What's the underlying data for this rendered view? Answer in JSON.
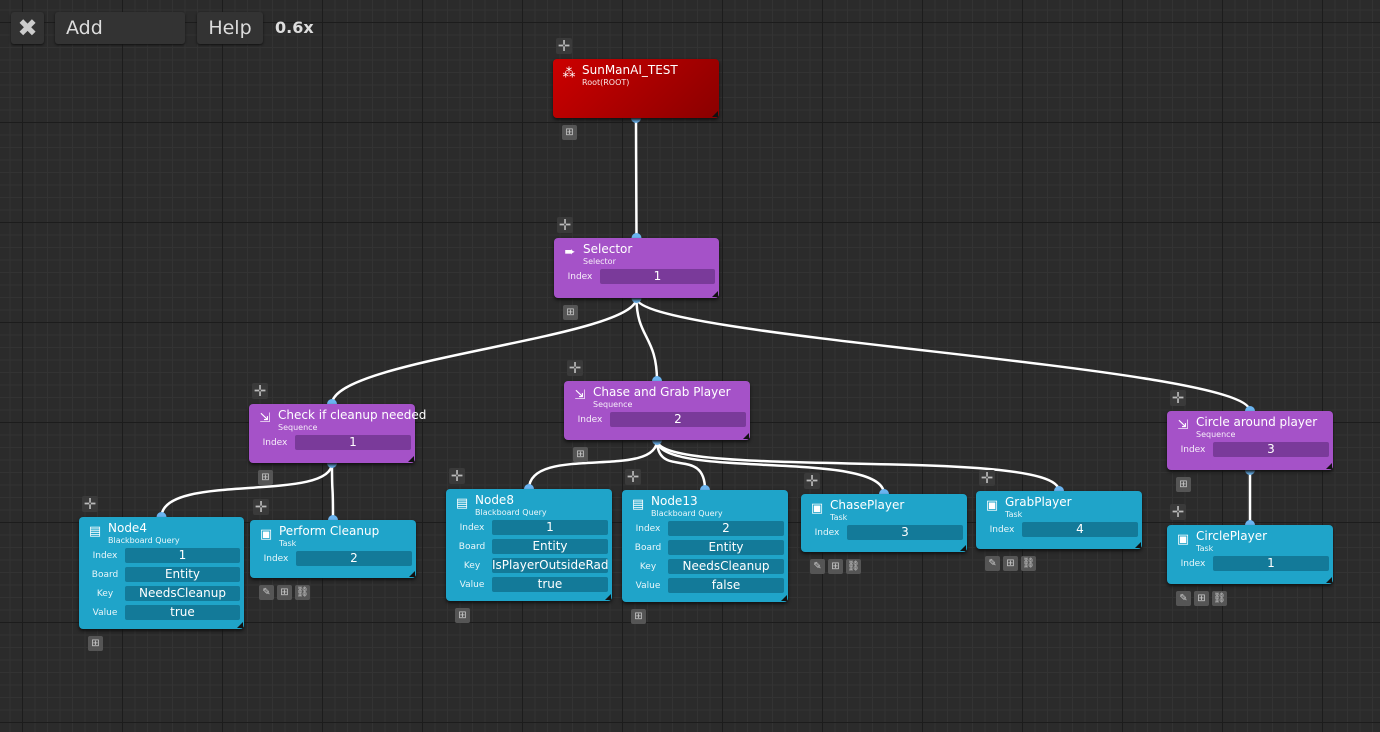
{
  "toolbar": {
    "close_icon": "close-icon",
    "add_label": "Add",
    "help_label": "Help",
    "zoom_level": "0.6x"
  },
  "colors": {
    "root": "#c00000",
    "composite": "#a552c8",
    "task": "#1fa4c9",
    "edge": "#ffffff",
    "port": "#6ab4f0"
  },
  "nodes": [
    {
      "id": "root",
      "kind": "root",
      "icon": "tree-icon",
      "title": "SunManAI_TEST",
      "subtitle": "Root(ROOT)",
      "fields": [],
      "tools": [
        "add"
      ]
    },
    {
      "id": "selector",
      "kind": "comp",
      "icon": "selector-icon",
      "title": "Selector",
      "subtitle": "Selector",
      "fields": [
        {
          "label": "Index",
          "value": "1"
        }
      ],
      "tools": [
        "add"
      ]
    },
    {
      "id": "check",
      "kind": "comp",
      "icon": "sequence-icon",
      "title": "Check if cleanup needed",
      "subtitle": "Sequence",
      "fields": [
        {
          "label": "Index",
          "value": "1"
        }
      ],
      "tools": [
        "add"
      ]
    },
    {
      "id": "chase",
      "kind": "comp",
      "icon": "sequence-icon",
      "title": "Chase and Grab Player",
      "subtitle": "Sequence",
      "fields": [
        {
          "label": "Index",
          "value": "2"
        }
      ],
      "tools": [
        "add"
      ]
    },
    {
      "id": "circle",
      "kind": "comp",
      "icon": "sequence-icon",
      "title": "Circle around player",
      "subtitle": "Sequence",
      "fields": [
        {
          "label": "Index",
          "value": "3"
        }
      ],
      "tools": [
        "add"
      ]
    },
    {
      "id": "node4",
      "kind": "task",
      "icon": "blackboard-icon",
      "title": "Node4",
      "subtitle": "Blackboard Query",
      "fields": [
        {
          "label": "Index",
          "value": "1"
        },
        {
          "label": "Board",
          "value": "Entity"
        },
        {
          "label": "Key",
          "value": "NeedsCleanup"
        },
        {
          "label": "Value",
          "value": "true"
        }
      ],
      "tools": [
        "add"
      ]
    },
    {
      "id": "perform",
      "kind": "task",
      "icon": "task-icon",
      "title": "Perform Cleanup",
      "subtitle": "Task",
      "fields": [
        {
          "label": "Index",
          "value": "2"
        }
      ],
      "tools": [
        "edit",
        "add",
        "link"
      ]
    },
    {
      "id": "node8",
      "kind": "task",
      "icon": "blackboard-icon",
      "title": "Node8",
      "subtitle": "Blackboard Query",
      "fields": [
        {
          "label": "Index",
          "value": "1"
        },
        {
          "label": "Board",
          "value": "Entity"
        },
        {
          "label": "Key",
          "value": "IsPlayerOutsideRadius"
        },
        {
          "label": "Value",
          "value": "true"
        }
      ],
      "tools": [
        "add"
      ]
    },
    {
      "id": "node13",
      "kind": "task",
      "icon": "blackboard-icon",
      "title": "Node13",
      "subtitle": "Blackboard Query",
      "fields": [
        {
          "label": "Index",
          "value": "2"
        },
        {
          "label": "Board",
          "value": "Entity"
        },
        {
          "label": "Key",
          "value": "NeedsCleanup"
        },
        {
          "label": "Value",
          "value": "false"
        }
      ],
      "tools": [
        "add"
      ]
    },
    {
      "id": "chaseplayer",
      "kind": "task",
      "icon": "task-icon",
      "title": "ChasePlayer",
      "subtitle": "Task",
      "fields": [
        {
          "label": "Index",
          "value": "3"
        }
      ],
      "tools": [
        "edit",
        "add",
        "link"
      ]
    },
    {
      "id": "grabplayer",
      "kind": "task",
      "icon": "task-icon",
      "title": "GrabPlayer",
      "subtitle": "Task",
      "fields": [
        {
          "label": "Index",
          "value": "4"
        }
      ],
      "tools": [
        "edit",
        "add",
        "link"
      ]
    },
    {
      "id": "circleplayer",
      "kind": "task",
      "icon": "task-icon",
      "title": "CirclePlayer",
      "subtitle": "Task",
      "fields": [
        {
          "label": "Index",
          "value": "1"
        }
      ],
      "tools": [
        "edit",
        "add",
        "link"
      ]
    }
  ],
  "edges": [
    [
      "root",
      "selector"
    ],
    [
      "selector",
      "check"
    ],
    [
      "selector",
      "chase"
    ],
    [
      "selector",
      "circle"
    ],
    [
      "check",
      "node4"
    ],
    [
      "check",
      "perform"
    ],
    [
      "chase",
      "node8"
    ],
    [
      "chase",
      "node13"
    ],
    [
      "chase",
      "chaseplayer"
    ],
    [
      "chase",
      "grabplayer"
    ],
    [
      "circle",
      "circleplayer"
    ]
  ]
}
